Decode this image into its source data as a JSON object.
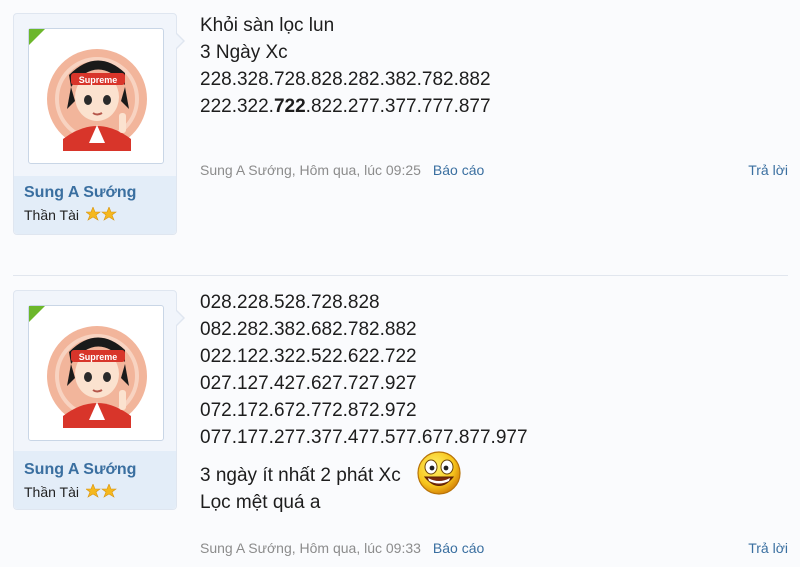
{
  "posts": [
    {
      "author": "Sung A Sướng",
      "title": "Thần Tài",
      "lines": [
        "Khỏi sàn lọc lun",
        "3 Ngày Xc",
        "228.328.728.828.282.382.782.882"
      ],
      "line4_pre": "222.322.",
      "line4_bold": "722",
      "line4_post": ".822.277.377.777.877",
      "meta": "Sung A Sướng, Hôm qua, lúc 09:25",
      "report": "Báo cáo",
      "reply": "Trả lời"
    },
    {
      "author": "Sung A Sướng",
      "title": "Thần Tài",
      "lines": [
        "028.228.528.728.828",
        "082.282.382.682.782.882",
        "022.122.322.522.622.722",
        "027.127.427.627.727.927",
        "072.172.672.772.872.972",
        "077.177.277.377.477.577.677.877.977"
      ],
      "extra_lines": [
        "3 ngày ít nhất 2 phát Xc",
        "Lọc mệt quá a"
      ],
      "meta": "Sung A Sướng, Hôm qua, lúc 09:33",
      "report": "Báo cáo",
      "reply": "Trả lời"
    }
  ],
  "icons": {
    "avatar": "avatar-image",
    "stars": "star-icon",
    "smiley": "smiley-icon"
  },
  "colors": {
    "link": "#3a6fa0",
    "flag": "#6cb72b",
    "muted": "#8c8c8c"
  }
}
